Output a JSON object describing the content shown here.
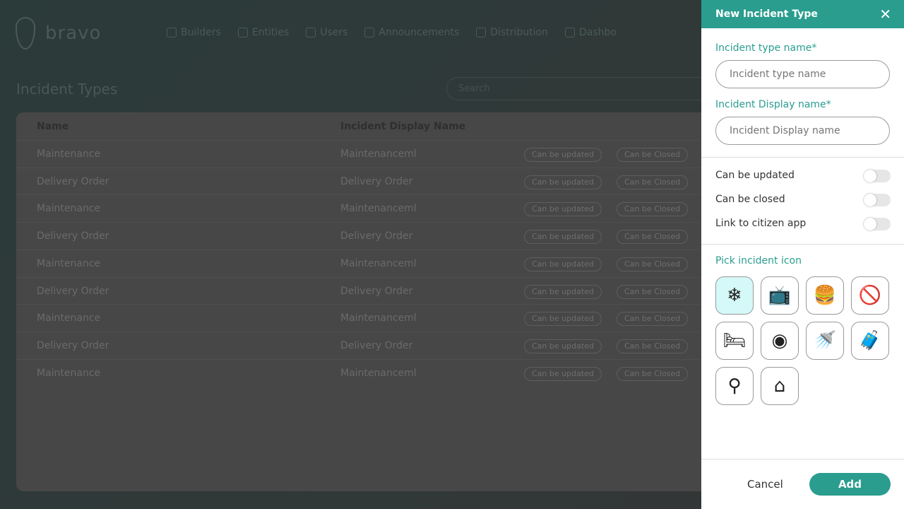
{
  "brand": "bravo",
  "nav": [
    "Builders",
    "Entities",
    "Users",
    "Announcements",
    "Distribution",
    "Dashbo"
  ],
  "page_title": "Incident Types",
  "search_placeholder": "Search",
  "table": {
    "headers": [
      "Name",
      "Incident Display Name"
    ],
    "rows": [
      {
        "name": "Maintenance",
        "display": "Maintenanceml"
      },
      {
        "name": "Delivery Order",
        "display": "Delivery Order"
      },
      {
        "name": "Maintenance",
        "display": "Maintenanceml"
      },
      {
        "name": "Delivery Order",
        "display": "Delivery Order"
      },
      {
        "name": "Maintenance",
        "display": "Maintenanceml"
      },
      {
        "name": "Delivery Order",
        "display": "Delivery Order"
      },
      {
        "name": "Maintenance",
        "display": "Maintenanceml"
      },
      {
        "name": "Delivery Order",
        "display": "Delivery Order"
      },
      {
        "name": "Maintenance",
        "display": "Maintenanceml"
      }
    ],
    "badges": [
      "Can be updated",
      "Can be Closed"
    ]
  },
  "panel": {
    "title": "New Incident Type",
    "type_label": "Incident type name*",
    "type_placeholder": "Incident type name",
    "display_label": "Incident Display name*",
    "display_placeholder": "Incident Display name",
    "toggles": [
      {
        "label": "Can be updated",
        "on": false
      },
      {
        "label": "Can be closed",
        "on": false
      },
      {
        "label": "Link to citizen app",
        "on": false
      }
    ],
    "icon_label": "Pick incident icon",
    "icons": [
      "air-conditioner",
      "television",
      "fast-food",
      "no-car",
      "bed",
      "wifi",
      "shower",
      "suitcase",
      "vacuum-cleaner",
      "towel-hanger"
    ],
    "selected_icon": "air-conditioner",
    "cancel": "Cancel",
    "add": "Add"
  },
  "colors": {
    "accent": "#2a9d8f",
    "selected_icon_bg": "#d5f8f8"
  }
}
